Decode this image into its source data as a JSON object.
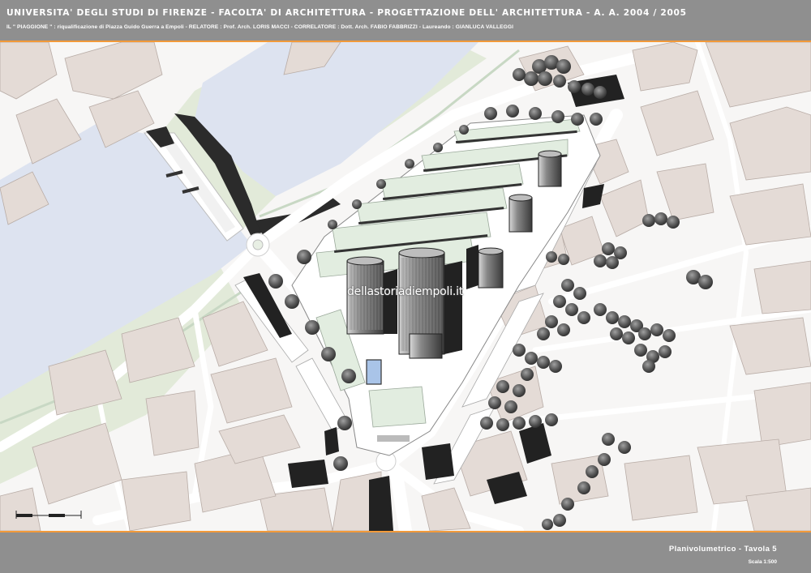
{
  "header": {
    "title": "UNIVERSITA' DEGLI STUDI DI FIRENZE  -  FACOLTA' DI ARCHITETTURA  -  PROGETTAZIONE DELL' ARCHITETTURA  -  A. A. 2004 / 2005",
    "subtitle": "IL \" PIAGGIONE \" : riqualificazione di Piazza Guido Guerra a Empoli  -  RELATORE :  Prof. Arch. LORIS MACCI  -  CORRELATORE :  Dott. Arch. FABIO FABBRIZZI  -  Laureando :  GIANLUCA  VALLEGGI"
  },
  "map": {
    "watermark": "dellastoriadiempoli.it"
  },
  "footer": {
    "tavola": "Planivolumetrico  -  Tavola 5",
    "scale": "Scala 1:500"
  },
  "colors": {
    "frame_grey": "#8f8f8f",
    "accent_orange": "#f29a3a",
    "river": "#dde3f0",
    "riverbank_green": "#dfe9dc",
    "building_pink": "#e4dbd6",
    "building_dark": "#2b2b2b",
    "lawn_green": "#e2ede0",
    "tree_dark": "#4a4a4a",
    "tree_light": "#9a9a9a"
  },
  "icons": [
    "tree-icon",
    "scale-bar-icon"
  ]
}
